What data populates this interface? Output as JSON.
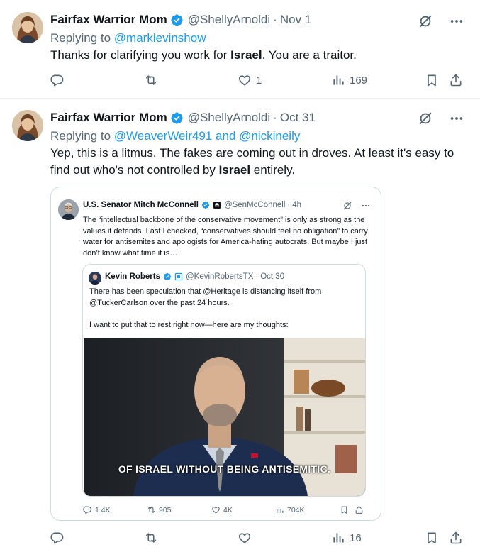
{
  "tweets": [
    {
      "author_name": "Fairfax Warrior Mom",
      "handle": "@ShellyArnoldi",
      "separator": "·",
      "date": "Nov 1",
      "replying_prefix": "Replying to",
      "replying_to": "@marklevinshow",
      "text_before": "Thanks for clarifying you work for ",
      "text_bold": "Israel",
      "text_after": ". You are a traitor.",
      "stats": {
        "replies": "",
        "retweets": "",
        "likes": "1",
        "views": "169"
      }
    },
    {
      "author_name": "Fairfax Warrior Mom",
      "handle": "@ShellyArnoldi",
      "separator": "·",
      "date": "Oct 31",
      "replying_prefix": "Replying to",
      "replying_to": "@WeaverWeir491 and @nickineily",
      "text_before": "Yep, this is a litmus. The fakes are coming out in droves. At least it's easy to find out who's not controlled by ",
      "text_bold": "Israel",
      "text_after": " entirely.",
      "stats": {
        "replies": "",
        "retweets": "",
        "likes": "",
        "views": "16"
      }
    }
  ],
  "quote": {
    "author_name": "U.S. Senator Mitch McConnell",
    "handle": "@SenMcConnell",
    "separator": "·",
    "time": "4h",
    "text": "The “intellectual backbone of the conservative movement” is only as strong as the values it defends. Last I checked, “conservatives should feel no obligation” to carry water for antisemites and apologists for America-hating autocrats. But maybe I just don’t know what time it is…",
    "inner": {
      "author_name": "Kevin Roberts",
      "handle": "@KevinRobertsTX",
      "separator": "·",
      "date": "Oct 30",
      "paragraph1": "There has been speculation that @Heritage is distancing itself from @TuckerCarlson over the past 24 hours.",
      "paragraph2": "I want to put that to rest right now—here are my thoughts:",
      "video_caption": "OF ISRAEL WITHOUT BEING ANTISEMITIC."
    },
    "stats": {
      "replies": "1.4K",
      "retweets": "905",
      "likes": "4K",
      "views": "704K"
    }
  },
  "colors": {
    "accent": "#1d9bf0",
    "secondary_text": "#536471",
    "primary_text": "#0f1419",
    "border": "#cfd9de",
    "verified": "#1d9bf0"
  },
  "icons": [
    "verified-badge-icon",
    "grok-icon",
    "more-icon",
    "reply-icon",
    "retweet-icon",
    "like-icon",
    "views-icon",
    "bookmark-icon",
    "share-icon",
    "affiliate-badge-icon"
  ]
}
